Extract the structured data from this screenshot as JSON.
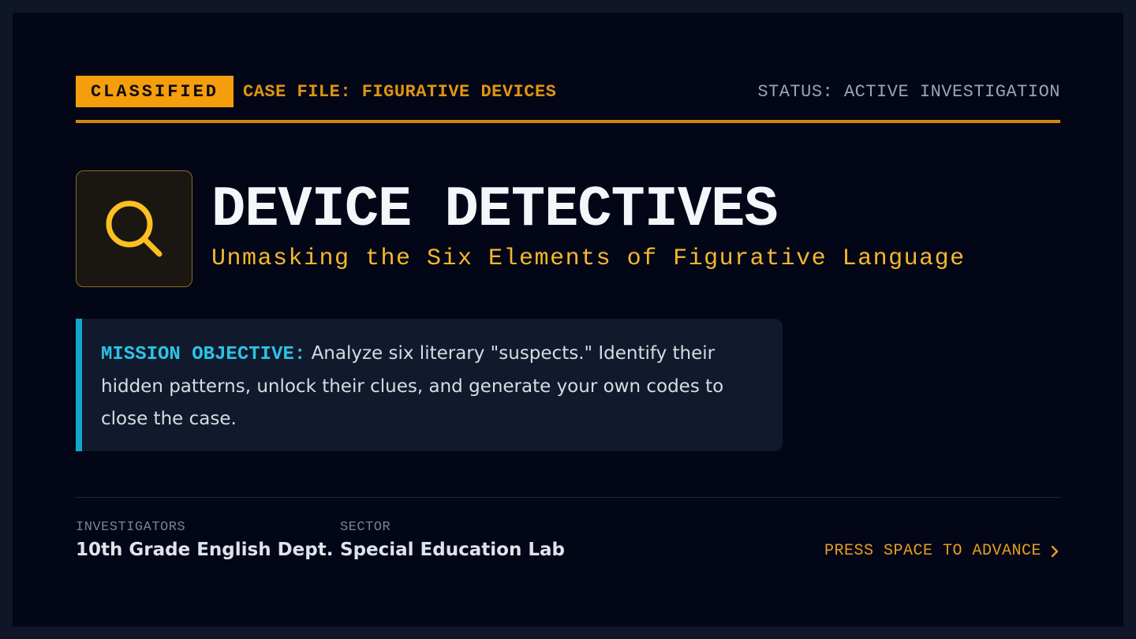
{
  "header": {
    "badge": "CLASSIFIED",
    "case_file": "CASE FILE: FIGURATIVE DEVICES",
    "status": "STATUS: ACTIVE INVESTIGATION"
  },
  "hero": {
    "icon": "magnifying-glass-icon",
    "title": "DEVICE DETECTIVES",
    "subtitle": "Unmasking the Six Elements of Figurative Language"
  },
  "mission": {
    "label": "MISSION OBJECTIVE:",
    "text": "Analyze six literary \"suspects.\" Identify their hidden patterns, unlock their clues, and generate your own codes to close the case."
  },
  "footer": {
    "investigators_label": "INVESTIGATORS",
    "investigators_value": "10th Grade English Dept.",
    "sector_label": "SECTOR",
    "sector_value": "Special Education Lab",
    "advance_label": "PRESS SPACE TO ADVANCE",
    "advance_icon": "chevron-right-icon"
  },
  "colors": {
    "accent": "#f59e0b",
    "cyan": "#12a7cc",
    "background": "#030616"
  }
}
